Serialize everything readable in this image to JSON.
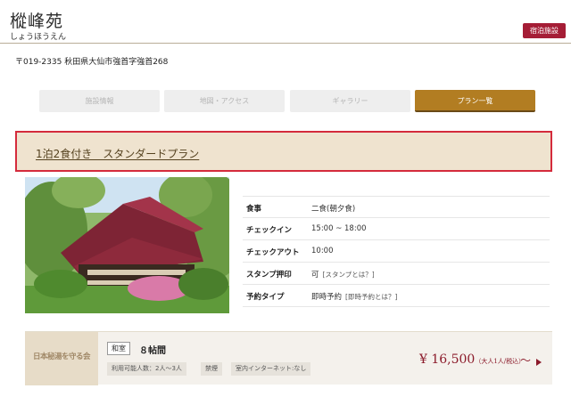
{
  "header": {
    "title": "樅峰苑",
    "kana": "しょうほうえん",
    "lodging_button": "宿泊施設"
  },
  "address": "〒019-2335 秋田県大仙市強首字強首268",
  "tabs": [
    {
      "label": "施設情報"
    },
    {
      "label": "地図・アクセス"
    },
    {
      "label": "ギャラリー"
    },
    {
      "label": "プラン一覧"
    }
  ],
  "plan": {
    "title": "1泊2食付き　スタンダードプラン"
  },
  "details": [
    {
      "label": "食事",
      "value": "二食(朝夕食)",
      "sub": ""
    },
    {
      "label": "チェックイン",
      "value": "15:00 ~ 18:00",
      "sub": ""
    },
    {
      "label": "チェックアウト",
      "value": "10:00",
      "sub": ""
    },
    {
      "label": "スタンプ押印",
      "value": "可",
      "sub": "[スタンプとは？]"
    },
    {
      "label": "予約タイプ",
      "value": "即時予約",
      "sub": "[即時予約とは？]"
    }
  ],
  "room": {
    "logo_text": "日本秘湯を守る会",
    "type": "和室",
    "name": "８帖間",
    "tags": [
      "利用可能人数：2人〜3人",
      "禁煙",
      "室内インターネット:なし"
    ],
    "price": "¥ 16,500",
    "price_note": "（大人1人/税込）",
    "price_wave": "〜"
  },
  "colors": {
    "accent_gold": "#b27d22",
    "lodging_red": "#a51d36",
    "highlight_border": "#d42b3c",
    "price_red": "#8b1a2a"
  }
}
